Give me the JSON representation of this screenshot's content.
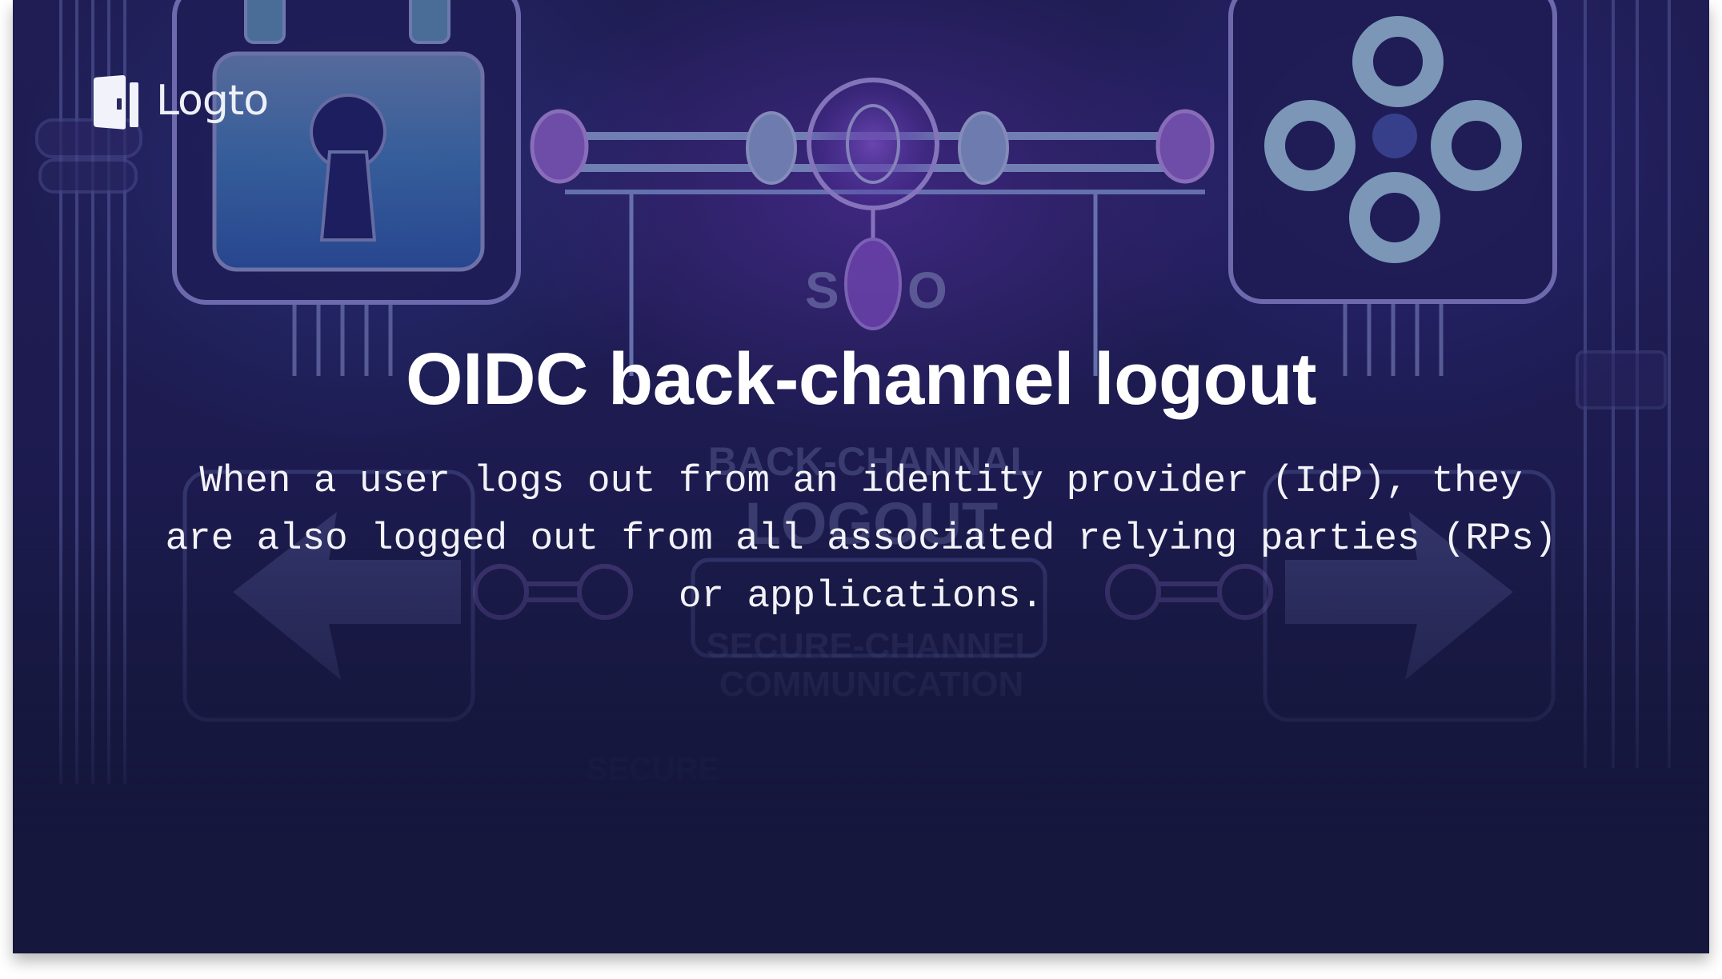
{
  "brand": {
    "name": "Logto",
    "logo_icon": "door-icon"
  },
  "hero": {
    "title": "OIDC back-channel logout",
    "description": "When a user logs out from an identity provider (IdP), they\nare also logged out from all associated relying parties (RPs)\nor applications."
  },
  "background": {
    "illustration_icons": [
      "padlock-icon",
      "sso-hub-icon",
      "gamepad-buttons-icon",
      "arrow-left-icon",
      "arrow-right-icon"
    ],
    "faint_labels": [
      "SSO",
      "BACK-CHANNAL",
      "LOGOUT",
      "SECURE-CHANNEL",
      "COMMUNICATION",
      "SECURE"
    ],
    "colors": {
      "base": "#16173d",
      "glow_purple": "#7a3fd8",
      "line": "#9aa6e0",
      "lock_fill": "#4a7fc0"
    }
  }
}
